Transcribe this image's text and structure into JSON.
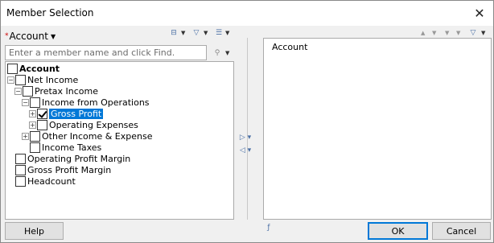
{
  "window": {
    "title": "Member Selection",
    "close_glyph": "✕"
  },
  "dimension": {
    "required_marker": "*",
    "name": "Account"
  },
  "search": {
    "placeholder": "Enter a member name and click Find."
  },
  "tree": [
    {
      "label": "Account",
      "bold": true,
      "expander": "",
      "checked": false,
      "selected": false
    },
    {
      "label": "Net Income",
      "bold": false,
      "expander": "−",
      "checked": false,
      "selected": false
    },
    {
      "label": "Pretax Income",
      "bold": false,
      "expander": "−",
      "checked": false,
      "selected": false
    },
    {
      "label": "Income from Operations",
      "bold": false,
      "expander": "−",
      "checked": false,
      "selected": false
    },
    {
      "label": "Gross Profit",
      "bold": false,
      "expander": "+",
      "checked": true,
      "selected": true
    },
    {
      "label": "Operating Expenses",
      "bold": false,
      "expander": "+",
      "checked": false,
      "selected": false
    },
    {
      "label": "Other Income & Expense",
      "bold": false,
      "expander": "+",
      "checked": false,
      "selected": false
    },
    {
      "label": "Income Taxes",
      "bold": false,
      "expander": "",
      "checked": false,
      "selected": false
    },
    {
      "label": "Operating Profit Margin",
      "bold": false,
      "expander": "",
      "checked": false,
      "selected": false
    },
    {
      "label": "Gross Profit Margin",
      "bold": false,
      "expander": "",
      "checked": false,
      "selected": false
    },
    {
      "label": "Headcount",
      "bold": false,
      "expander": "",
      "checked": false,
      "selected": false
    }
  ],
  "selection": {
    "items": [
      "Account"
    ]
  },
  "buttons": {
    "help": "Help",
    "ok": "OK",
    "cancel": "Cancel"
  },
  "icons": {
    "tree_view": "tree-view-icon",
    "filter": "filter-icon",
    "sort": "sort-icon",
    "find": "find-icon",
    "move_up": "move-up-icon",
    "move_down": "move-down-icon",
    "add": "add-to-selection-icon",
    "remove": "remove-from-selection-icon"
  },
  "colors": {
    "selection_highlight": "#0078d7",
    "required_marker": "#cc0000"
  }
}
